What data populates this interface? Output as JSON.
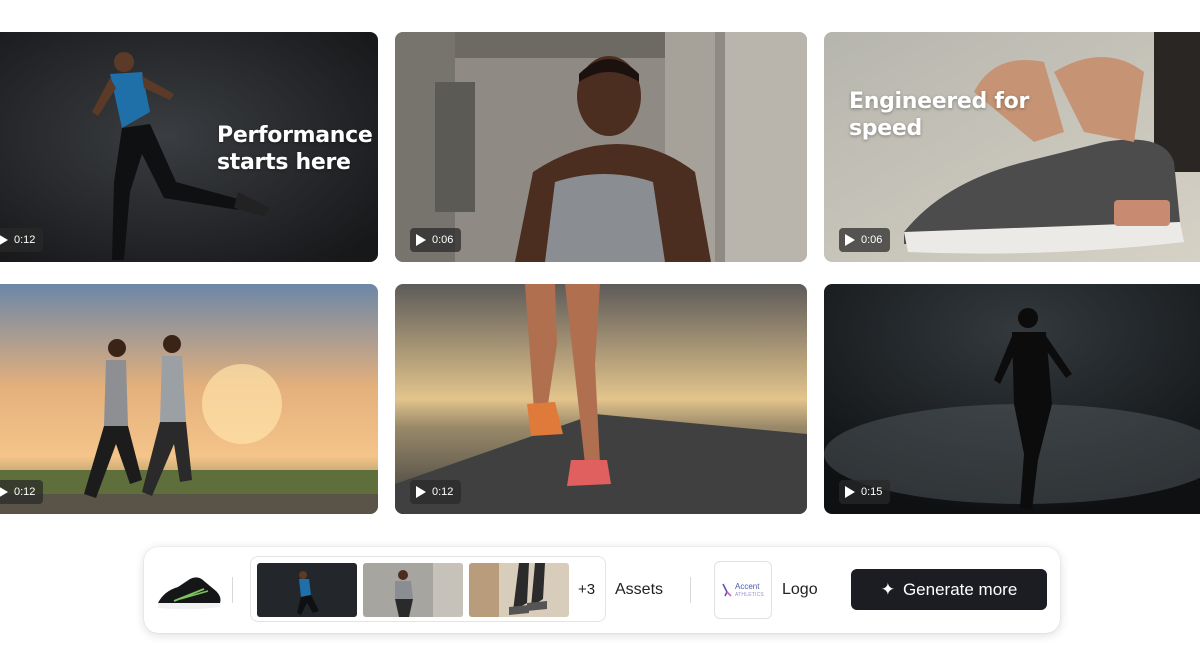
{
  "videos": [
    {
      "caption_lines": [
        "Performance",
        "starts here"
      ],
      "duration": "0:12",
      "scene": "sprinter-dark-studio"
    },
    {
      "caption_lines": [],
      "duration": "0:06",
      "scene": "man-tank-top-concrete"
    },
    {
      "caption_lines": [
        "Engineered for",
        "speed"
      ],
      "duration": "0:06",
      "scene": "tying-sneaker"
    },
    {
      "caption_lines": [],
      "duration": "0:12",
      "scene": "couple-running-sunset"
    },
    {
      "caption_lines": [],
      "duration": "0:12",
      "scene": "runner-legs-road"
    },
    {
      "caption_lines": [],
      "duration": "0:15",
      "scene": "silhouette-runner-fog"
    }
  ],
  "toolbar": {
    "product_icon": "sneaker-thumbnail",
    "extra_assets_count": "+3",
    "assets_label": "Assets",
    "logo_brand_lines": [
      "Accent",
      "ATHLETICS"
    ],
    "logo_label": "Logo",
    "generate_label": "Generate more",
    "generate_icon": "sparkle-icon"
  },
  "colors": {
    "button_bg": "#1c1d22",
    "logo_accent": "#4a5aa8"
  }
}
